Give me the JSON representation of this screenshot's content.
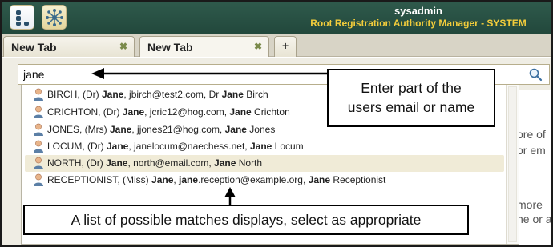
{
  "header": {
    "user_name": "sysadmin",
    "role": "Root Registration Authority Manager - SYSTEM",
    "apps": [
      {
        "icon": "workflow-app-icon"
      },
      {
        "icon": "network-app-icon"
      }
    ]
  },
  "tabs": [
    {
      "label": "New Tab",
      "close": "✖"
    },
    {
      "label": "New Tab",
      "close": "✖"
    }
  ],
  "add_tab_label": "+",
  "search": {
    "value": "jane",
    "icon": "search-icon"
  },
  "background_text": [
    "ore  of",
    "or em",
    "more",
    "ne or a"
  ],
  "results": [
    {
      "prefix": "BIRCH, (Dr) ",
      "first": "Jane",
      "mid1": ", jbirch@test2.com, Dr ",
      "first2": "Jane",
      "rest": " Birch",
      "icon": "person-icon"
    },
    {
      "prefix": "CRICHTON, (Dr) ",
      "first": "Jane",
      "mid1": ", jcric12@hog.com, ",
      "first2": "Jane",
      "rest": " Crichton",
      "icon": "person-icon"
    },
    {
      "prefix": "JONES, (Mrs) ",
      "first": "Jane",
      "mid1": ", jjones21@hog.com, ",
      "first2": "Jane",
      "rest": " Jones",
      "icon": "person-icon"
    },
    {
      "prefix": "LOCUM, (Dr) ",
      "first": "Jane",
      "mid1": ", janelocum@naechess.net, ",
      "first2": "Jane",
      "rest": " Locum",
      "icon": "person-icon"
    },
    {
      "prefix": "NORTH, (Dr) ",
      "first": "Jane",
      "mid1": ", north@email.com, ",
      "first2": "Jane",
      "rest": " North",
      "icon": "person-icon",
      "highlighted": true
    },
    {
      "prefix": "RECEPTIONIST, (Miss) ",
      "first": "Jane",
      "mid1": ", ",
      "email_bold": "jane",
      "mid2": ".reception@example.org, ",
      "first2": "Jane",
      "rest": " Receptionist",
      "icon": "person-icon"
    }
  ],
  "callouts": {
    "search_hint": [
      "Enter part of the",
      "users email or name"
    ],
    "list_hint": "A list of possible matches displays, select as appropriate"
  },
  "colors": {
    "header_bg": "#2f5a4c",
    "role_text": "#f2cc3b",
    "highlight_row": "#f0ebd7"
  }
}
